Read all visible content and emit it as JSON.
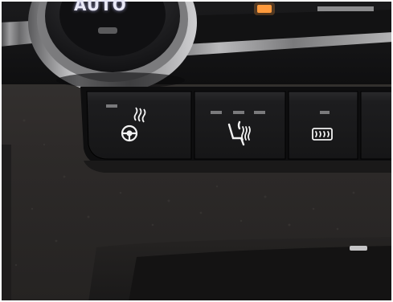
{
  "dial": {
    "label": "AUTO",
    "icon": "climate-dial-icon"
  },
  "buttons": [
    {
      "icon": "heated-steering-wheel-icon",
      "indicator_leds": 1,
      "active": false
    },
    {
      "icon": "heated-seat-icon",
      "indicator_leds": 3,
      "active": false
    },
    {
      "icon": "rear-defrost-icon",
      "indicator_leds": 1,
      "active": false
    }
  ],
  "colors": {
    "dashboard": "#2f2c2b",
    "button_face": "#1c1c1e",
    "icon_white": "#f2f2f2",
    "chrome": "#b9b9bb",
    "amber_light": "#ff9a3c"
  }
}
